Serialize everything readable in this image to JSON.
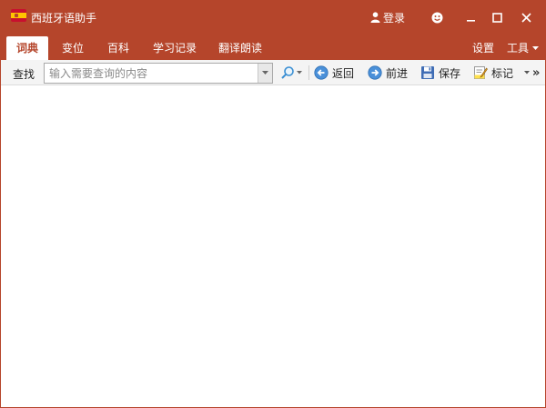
{
  "window": {
    "title": "西班牙语助手",
    "logo_icon": "spain-flag-icon",
    "accent_color": "#b5452b"
  },
  "titlebar": {
    "login_label": "登录",
    "login_icon": "user-icon",
    "buttons": [
      "smiley-icon",
      "minimize-icon",
      "maximize-icon",
      "close-icon"
    ]
  },
  "menubar": {
    "tabs": [
      {
        "label": "词典",
        "active": true
      },
      {
        "label": "变位",
        "active": false
      },
      {
        "label": "百科",
        "active": false
      },
      {
        "label": "学习记录",
        "active": false
      },
      {
        "label": "翻译朗读",
        "active": false
      }
    ],
    "settings_label": "设置",
    "tools_label": "工具"
  },
  "toolbar": {
    "search_label": "查找",
    "search_placeholder": "输入需要查询的内容",
    "search_value": "",
    "back_label": "返回",
    "forward_label": "前进",
    "save_label": "保存",
    "mark_label": "标记",
    "more_glyph": "»"
  }
}
